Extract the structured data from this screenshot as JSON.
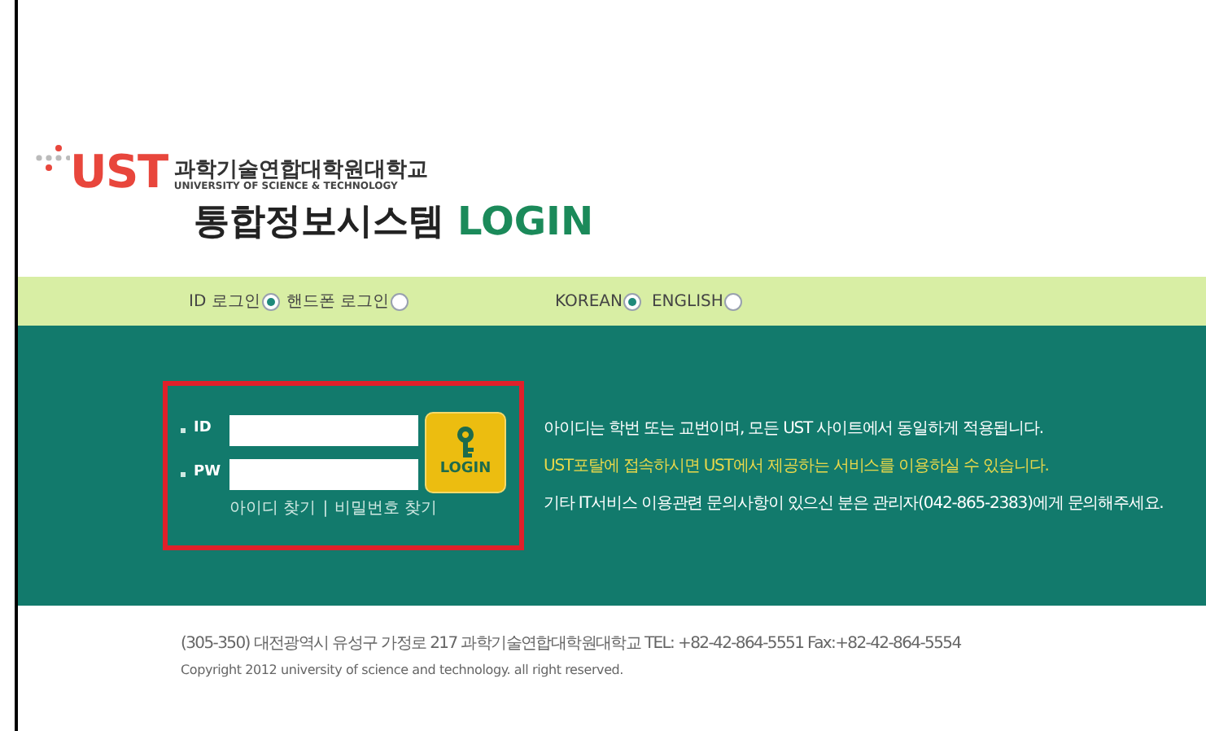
{
  "logo": {
    "mark": "UST",
    "name_ko": "과학기술연합대학원대학교",
    "name_en": "UNIVERSITY OF SCIENCE & TECHNOLOGY"
  },
  "title": {
    "text": "통합정보시스템",
    "accent": "LOGIN"
  },
  "login_types": [
    {
      "label": "ID 로그인",
      "selected": true
    },
    {
      "label": "핸드폰 로그인",
      "selected": false
    }
  ],
  "languages": [
    {
      "label": "KOREAN",
      "selected": true
    },
    {
      "label": "ENGLISH",
      "selected": false
    }
  ],
  "form": {
    "id_label": "ID",
    "pw_label": "PW",
    "login_button": "LOGIN",
    "links": [
      "아이디 찾기",
      "비밀번호 찾기"
    ],
    "separator": "|"
  },
  "notices": [
    {
      "text": "아이디는 학번 또는 교번이며, 모든 UST 사이트에서 동일하게 적용됩니다.",
      "kind": "normal"
    },
    {
      "text": "UST포탈에 접속하시면 UST에서 제공하는 서비스를 이용하실 수 있습니다.",
      "kind": "highlight"
    },
    {
      "text": "기타 IT서비스 이용관련 문의사항이 있으신 분은 관리자(042-865-2383)에게 문의해주세요.",
      "kind": "normal"
    }
  ],
  "footer": {
    "address": "(305-350) 대전광역시 유성구 가정로 217 과학기술연합대학원대학교 TEL: +82-42-864-5551 Fax:+82-42-864-5554",
    "copyright": "Copyright 2012 university of science and technology. all right reserved."
  }
}
